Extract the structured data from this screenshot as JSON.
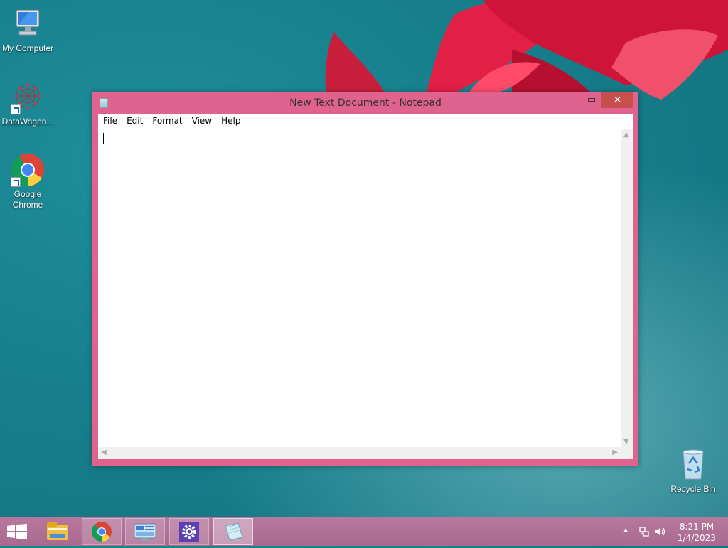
{
  "desktop": {
    "icons": [
      {
        "label": "My Computer"
      },
      {
        "label": "DataWagon..."
      },
      {
        "label": "Google Chrome"
      },
      {
        "label": "Recycle Bin"
      }
    ]
  },
  "window": {
    "title": "New Text Document - Notepad",
    "controls": {
      "minimize": "—",
      "maximize": "▭",
      "close": "✕"
    },
    "menu": [
      "File",
      "Edit",
      "Format",
      "View",
      "Help"
    ],
    "content": ""
  },
  "taskbar": {
    "items": [
      {
        "icon": "file-explorer-icon"
      },
      {
        "icon": "chrome-icon"
      },
      {
        "icon": "control-panel-icon"
      },
      {
        "icon": "settings-gear-icon"
      },
      {
        "icon": "notepad-icon"
      }
    ],
    "tray": {
      "up_arrow": "▲"
    },
    "clock": {
      "time": "8:21 PM",
      "date": "1/4/2023"
    }
  },
  "colors": {
    "window_frame": "#e0628e",
    "close_button": "#c7504f",
    "taskbar": "#b07091",
    "desktop_bg": "#17808d"
  }
}
